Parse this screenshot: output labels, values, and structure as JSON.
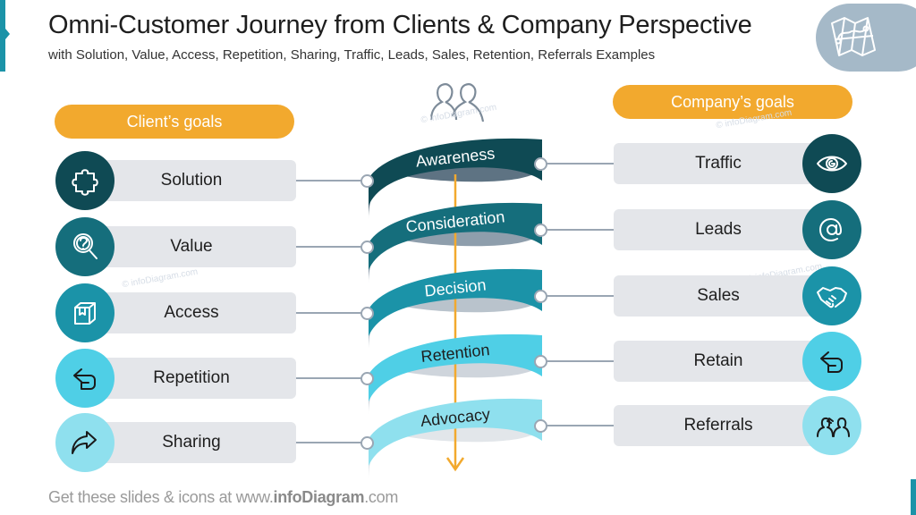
{
  "header": {
    "title": "Omni-Customer Journey from Clients & Company Perspective",
    "subtitle": "with Solution, Value, Access, Repetition, Sharing, Traffic, Leads, Sales, Retention, Referrals Examples",
    "badge_icon": "map-icon"
  },
  "client_goals": {
    "label": "Client’s goals",
    "items": [
      {
        "label": "Solution",
        "icon": "puzzle-icon",
        "color": "#0f4a54"
      },
      {
        "label": "Value",
        "icon": "magnifier-question-icon",
        "color": "#156e7c"
      },
      {
        "label": "Access",
        "icon": "box-icon",
        "color": "#1b93a8"
      },
      {
        "label": "Repetition",
        "icon": "return-arrow-icon",
        "color": "#4fcfe6"
      },
      {
        "label": "Sharing",
        "icon": "share-arrow-icon",
        "color": "#8fe0ee"
      }
    ]
  },
  "company_goals": {
    "label": "Company’s goals",
    "items": [
      {
        "label": "Traffic",
        "icon": "eye-icon",
        "color": "#0f4a54"
      },
      {
        "label": "Leads",
        "icon": "at-sign-icon",
        "color": "#156e7c"
      },
      {
        "label": "Sales",
        "icon": "handshake-icon",
        "color": "#1b93a8"
      },
      {
        "label": "Retain",
        "icon": "return-arrow-icon",
        "color": "#4fcfe6"
      },
      {
        "label": "Referrals",
        "icon": "referral-people-icon",
        "color": "#8fe0ee"
      }
    ]
  },
  "journey": {
    "top_icon": "people-icon",
    "stages": [
      {
        "label": "Awareness",
        "color": "#0f4a54",
        "text_color": "#ffffff"
      },
      {
        "label": "Consideration",
        "color": "#156e7c",
        "text_color": "#ffffff"
      },
      {
        "label": "Decision",
        "color": "#1b93a8",
        "text_color": "#ffffff"
      },
      {
        "label": "Retention",
        "color": "#4fcfe6",
        "text_color": "#1e1e1e"
      },
      {
        "label": "Advocacy",
        "color": "#8fe0ee",
        "text_color": "#1e1e1e"
      }
    ],
    "arrow_color": "#f2a92e"
  },
  "footer": {
    "prefix": "Get these slides & icons at www.",
    "brand": "infoDiagram",
    "suffix": ".com"
  },
  "watermark": "© infoDiagram.com"
}
